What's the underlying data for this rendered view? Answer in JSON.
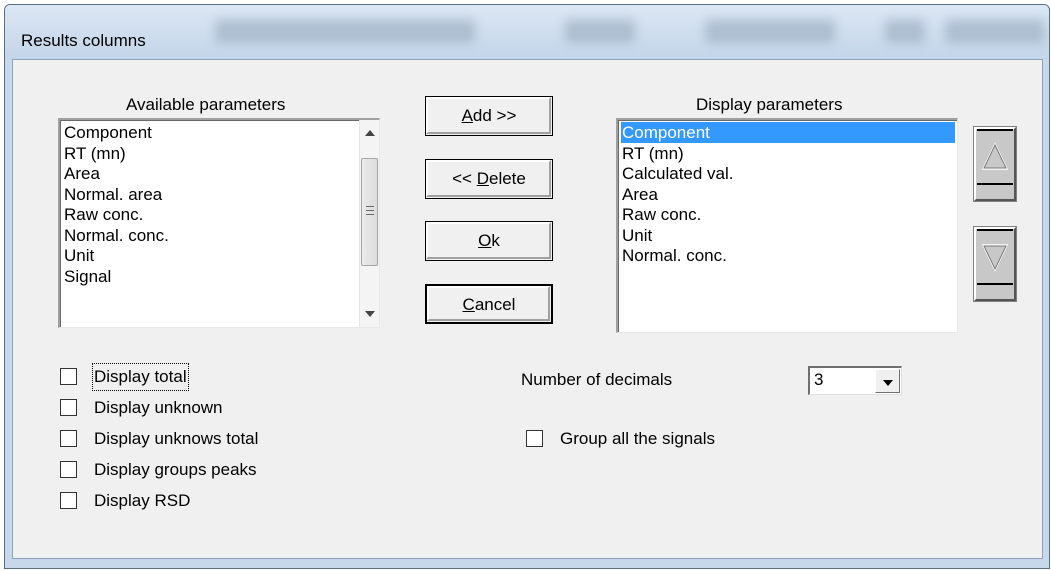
{
  "window": {
    "title": "Results columns",
    "background_header_fragments": [
      "CC (sen) Calculated val.",
      "Area",
      "Raw conc.",
      "Unit",
      "Normal."
    ]
  },
  "available": {
    "label": "Available parameters",
    "items": [
      "Component",
      "RT (mn)",
      "Area",
      "Normal. area",
      "Raw conc.",
      "Normal. conc.",
      "Unit",
      "Signal"
    ]
  },
  "display": {
    "label": "Display parameters",
    "items": [
      "Component",
      "RT (mn)",
      "Calculated val.",
      "Area",
      "Raw conc.",
      "Unit",
      "Normal. conc."
    ],
    "selected_index": 0
  },
  "buttons": {
    "add": {
      "pre": "",
      "accel": "A",
      "post": "dd >>"
    },
    "delete": {
      "pre": "<< ",
      "accel": "D",
      "post": "elete"
    },
    "ok": {
      "pre": "",
      "accel": "O",
      "post": "k"
    },
    "cancel": {
      "pre": "",
      "accel": "C",
      "post": "ancel"
    }
  },
  "move_buttons": {
    "up": "move-up",
    "down": "move-down"
  },
  "options": {
    "display_total": {
      "label": "Display total",
      "checked": false
    },
    "display_unknown": {
      "label": "Display unknown",
      "checked": false
    },
    "display_unknowns_total": {
      "label": "Display unknows total",
      "checked": false
    },
    "display_groups_peaks": {
      "label": "Display groups peaks",
      "checked": false
    },
    "display_rsd": {
      "label": "Display RSD",
      "checked": false
    },
    "group_all_signals": {
      "label": "Group all the signals",
      "checked": false
    }
  },
  "decimals": {
    "label": "Number of decimals",
    "value": "3"
  },
  "colors": {
    "selection": "#3399ff",
    "dialog_bg": "#f0f0f0",
    "frame": "#c7d8ea"
  }
}
